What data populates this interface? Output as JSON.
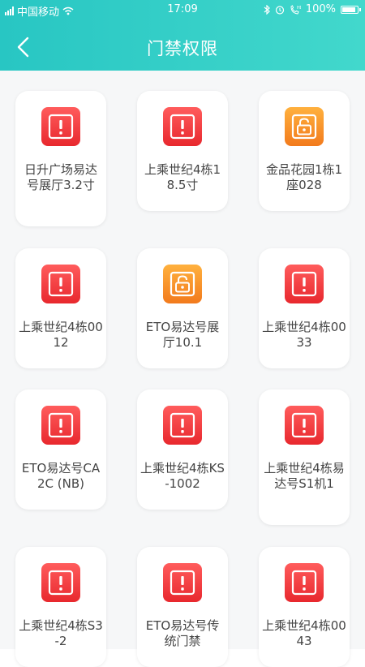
{
  "status_bar": {
    "carrier": "中国移动",
    "time": "17:09",
    "battery": "100%",
    "battery_level": 1.0,
    "icons": [
      "signal-icon",
      "wifi-icon",
      "bluetooth-icon",
      "alarm-icon",
      "call-icon",
      "battery-icon"
    ]
  },
  "header": {
    "title": "门禁权限",
    "back_icon": "chevron-left-icon",
    "gradient": [
      "#28c6c3",
      "#42d8cc"
    ]
  },
  "colors": {
    "locked": "#e8282e",
    "unlocked": "#f27a1c"
  },
  "doors": [
    {
      "label": "日升广场易达号展厅3.2寸",
      "state": "locked"
    },
    {
      "label": "上乘世纪4栋18.5寸",
      "state": "locked"
    },
    {
      "label": "金品花园1栋1座028",
      "state": "unlocked"
    },
    {
      "label": "上乘世纪4栋0012",
      "state": "locked"
    },
    {
      "label": "ETO易达号展厅10.1",
      "state": "unlocked"
    },
    {
      "label": "上乘世纪4栋0033",
      "state": "locked"
    },
    {
      "label": "ETO易达号CA2C (NB)",
      "state": "locked"
    },
    {
      "label": "上乘世纪4栋KS-1002",
      "state": "locked"
    },
    {
      "label": "上乘世纪4栋易达号S1机1",
      "state": "locked"
    },
    {
      "label": "上乘世纪4栋S3-2",
      "state": "locked"
    },
    {
      "label": "ETO易达号传统门禁",
      "state": "locked"
    },
    {
      "label": "上乘世纪4栋0043",
      "state": "locked"
    }
  ]
}
